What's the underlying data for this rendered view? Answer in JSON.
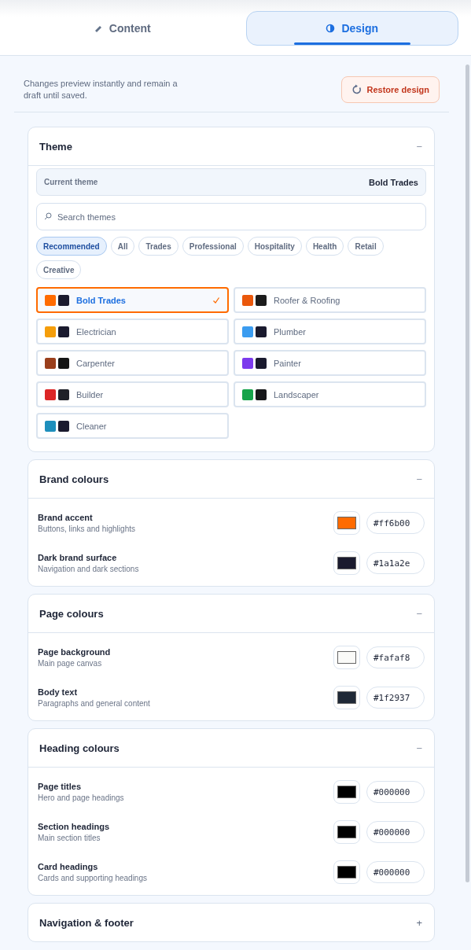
{
  "tabs": [
    {
      "label": "Content",
      "selected": false
    },
    {
      "label": "Design",
      "selected": true
    }
  ],
  "intro": {
    "text": "Changes preview instantly and remain a draft until saved.",
    "restore_button": "Restore design"
  },
  "sections": [
    {
      "kind": "themes",
      "title": "Theme",
      "toggle": "−",
      "expanded": true,
      "current_label": "Current theme",
      "current_value": "Bold Trades",
      "search": {
        "placeholder": "Search themes"
      },
      "filters": [
        {
          "label": "Recommended",
          "selected": true
        },
        {
          "label": "All",
          "selected": false
        },
        {
          "label": "Trades",
          "selected": false
        },
        {
          "label": "Professional",
          "selected": false
        },
        {
          "label": "Hospitality",
          "selected": false
        },
        {
          "label": "Health",
          "selected": false
        },
        {
          "label": "Retail",
          "selected": false
        },
        {
          "label": "Creative",
          "selected": false
        }
      ],
      "themes": [
        {
          "name": "Bold Trades",
          "swatches": [
            {
              "color": "#ff6b00"
            },
            {
              "color": "#1a1a2e"
            }
          ],
          "selected": true
        },
        {
          "name": "Roofer & Roofing",
          "swatches": [
            {
              "color": "#ea580c"
            },
            {
              "color": "#1c1c1c"
            }
          ],
          "selected": false
        },
        {
          "name": "Electrician",
          "swatches": [
            {
              "color": "#f59e0b"
            },
            {
              "color": "#1a1a2e"
            }
          ],
          "selected": false
        },
        {
          "name": "Plumber",
          "swatches": [
            {
              "color": "#3b9cf0"
            },
            {
              "color": "#1a1a2e"
            }
          ],
          "selected": false
        },
        {
          "name": "Carpenter",
          "swatches": [
            {
              "color": "#9a3f1c"
            },
            {
              "color": "#151515"
            }
          ],
          "selected": false
        },
        {
          "name": "Painter",
          "swatches": [
            {
              "color": "#7c3aed"
            },
            {
              "color": "#1a1a2e"
            }
          ],
          "selected": false
        },
        {
          "name": "Builder",
          "swatches": [
            {
              "color": "#dc2626"
            },
            {
              "color": "#1f2128"
            }
          ],
          "selected": false
        },
        {
          "name": "Landscaper",
          "swatches": [
            {
              "color": "#16a34a"
            },
            {
              "color": "#17181a"
            }
          ],
          "selected": false
        },
        {
          "name": "Cleaner",
          "swatches": [
            {
              "color": "#1e8fbc"
            },
            {
              "color": "#1a1a2e"
            }
          ],
          "selected": false
        }
      ]
    },
    {
      "kind": "colours",
      "title": "Brand colours",
      "toggle": "−",
      "expanded": true,
      "rows": [
        {
          "label": "Brand accent",
          "hint": "Buttons, links and highlights",
          "value": "#ff6b00"
        },
        {
          "label": "Dark brand surface",
          "hint": "Navigation and dark sections",
          "value": "#1a1a2e"
        }
      ]
    },
    {
      "kind": "colours",
      "title": "Page colours",
      "toggle": "−",
      "expanded": true,
      "rows": [
        {
          "label": "Page background",
          "hint": "Main page canvas",
          "value": "#fafaf8"
        },
        {
          "label": "Body text",
          "hint": "Paragraphs and general content",
          "value": "#1f2937"
        }
      ]
    },
    {
      "kind": "colours",
      "title": "Heading colours",
      "toggle": "−",
      "expanded": true,
      "rows": [
        {
          "label": "Page titles",
          "hint": "Hero and page headings",
          "value": "#000000"
        },
        {
          "label": "Section headings",
          "hint": "Main section titles",
          "value": "#000000"
        },
        {
          "label": "Card headings",
          "hint": "Cards and supporting headings",
          "value": "#000000"
        }
      ]
    },
    {
      "title": "Navigation & footer",
      "toggle": "+",
      "expanded": false
    }
  ]
}
